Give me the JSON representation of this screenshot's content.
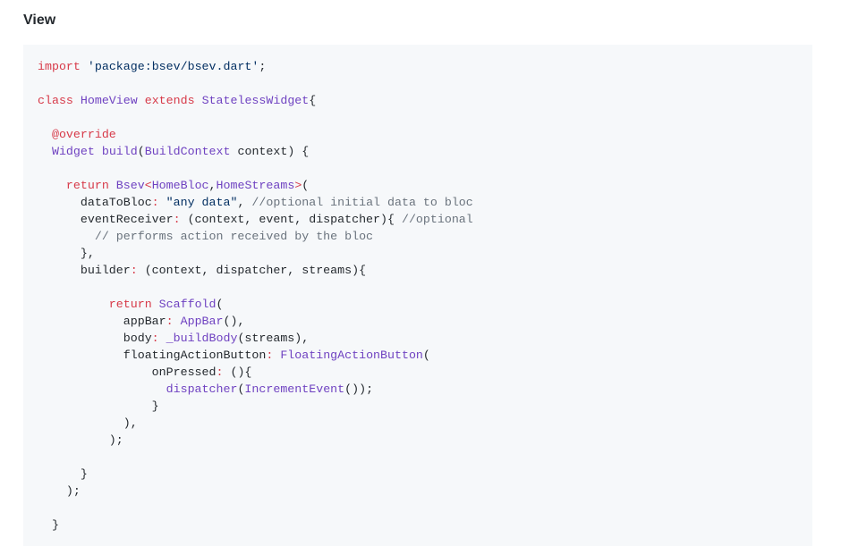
{
  "section": {
    "heading": "View"
  },
  "code": {
    "language": "dart",
    "colors": {
      "keyword": "#d73a49",
      "string": "#032f62",
      "class": "#6f42c1",
      "comment": "#6a737d",
      "plain": "#24292e",
      "background": "#f6f8fa"
    },
    "lines": [
      [
        [
          "kw",
          "import"
        ],
        [
          "pl",
          " "
        ],
        [
          "str",
          "'package:bsev/bsev.dart'"
        ],
        [
          "pl",
          ";"
        ]
      ],
      [],
      [
        [
          "kw",
          "class"
        ],
        [
          "pl",
          " "
        ],
        [
          "cls",
          "HomeView"
        ],
        [
          "pl",
          " "
        ],
        [
          "kw",
          "extends"
        ],
        [
          "pl",
          " "
        ],
        [
          "cls",
          "StatelessWidget"
        ],
        [
          "pl",
          "{"
        ]
      ],
      [],
      [
        [
          "pl",
          "  "
        ],
        [
          "an",
          "@override"
        ]
      ],
      [
        [
          "pl",
          "  "
        ],
        [
          "cls",
          "Widget"
        ],
        [
          "pl",
          " "
        ],
        [
          "cls",
          "build"
        ],
        [
          "pl",
          "("
        ],
        [
          "cls",
          "BuildContext"
        ],
        [
          "pl",
          " context) {"
        ]
      ],
      [],
      [
        [
          "pl",
          "    "
        ],
        [
          "kw",
          "return"
        ],
        [
          "pl",
          " "
        ],
        [
          "cls",
          "Bsev"
        ],
        [
          "kw",
          "<"
        ],
        [
          "cls",
          "HomeBloc"
        ],
        [
          "pl",
          ","
        ],
        [
          "cls",
          "HomeStreams"
        ],
        [
          "kw",
          ">"
        ],
        [
          "pl",
          "("
        ]
      ],
      [
        [
          "pl",
          "      dataToBloc"
        ],
        [
          "kw",
          ":"
        ],
        [
          "pl",
          " "
        ],
        [
          "str",
          "\"any data\""
        ],
        [
          "pl",
          ", "
        ],
        [
          "cm",
          "//optional initial data to bloc"
        ]
      ],
      [
        [
          "pl",
          "      eventReceiver"
        ],
        [
          "kw",
          ":"
        ],
        [
          "pl",
          " (context, event, dispatcher){ "
        ],
        [
          "cm",
          "//optional"
        ]
      ],
      [
        [
          "pl",
          "        "
        ],
        [
          "cm",
          "// performs action received by the bloc"
        ]
      ],
      [
        [
          "pl",
          "      },"
        ]
      ],
      [
        [
          "pl",
          "      builder"
        ],
        [
          "kw",
          ":"
        ],
        [
          "pl",
          " (context, dispatcher, streams){"
        ]
      ],
      [],
      [
        [
          "pl",
          "          "
        ],
        [
          "kw",
          "return"
        ],
        [
          "pl",
          " "
        ],
        [
          "cls",
          "Scaffold"
        ],
        [
          "pl",
          "("
        ]
      ],
      [
        [
          "pl",
          "            appBar"
        ],
        [
          "kw",
          ":"
        ],
        [
          "pl",
          " "
        ],
        [
          "cls",
          "AppBar"
        ],
        [
          "pl",
          "(),"
        ]
      ],
      [
        [
          "pl",
          "            body"
        ],
        [
          "kw",
          ":"
        ],
        [
          "pl",
          " "
        ],
        [
          "cls",
          "_buildBody"
        ],
        [
          "pl",
          "(streams),"
        ]
      ],
      [
        [
          "pl",
          "            floatingActionButton"
        ],
        [
          "kw",
          ":"
        ],
        [
          "pl",
          " "
        ],
        [
          "cls",
          "FloatingActionButton"
        ],
        [
          "pl",
          "("
        ]
      ],
      [
        [
          "pl",
          "                onPressed"
        ],
        [
          "kw",
          ":"
        ],
        [
          "pl",
          " (){"
        ]
      ],
      [
        [
          "pl",
          "                  "
        ],
        [
          "cls",
          "dispatcher"
        ],
        [
          "pl",
          "("
        ],
        [
          "cls",
          "IncrementEvent"
        ],
        [
          "pl",
          "());"
        ]
      ],
      [
        [
          "pl",
          "                }"
        ]
      ],
      [
        [
          "pl",
          "            ),"
        ]
      ],
      [
        [
          "pl",
          "          );"
        ]
      ],
      [],
      [
        [
          "pl",
          "      }"
        ]
      ],
      [
        [
          "pl",
          "    );"
        ]
      ],
      [],
      [
        [
          "pl",
          "  }"
        ]
      ]
    ]
  }
}
